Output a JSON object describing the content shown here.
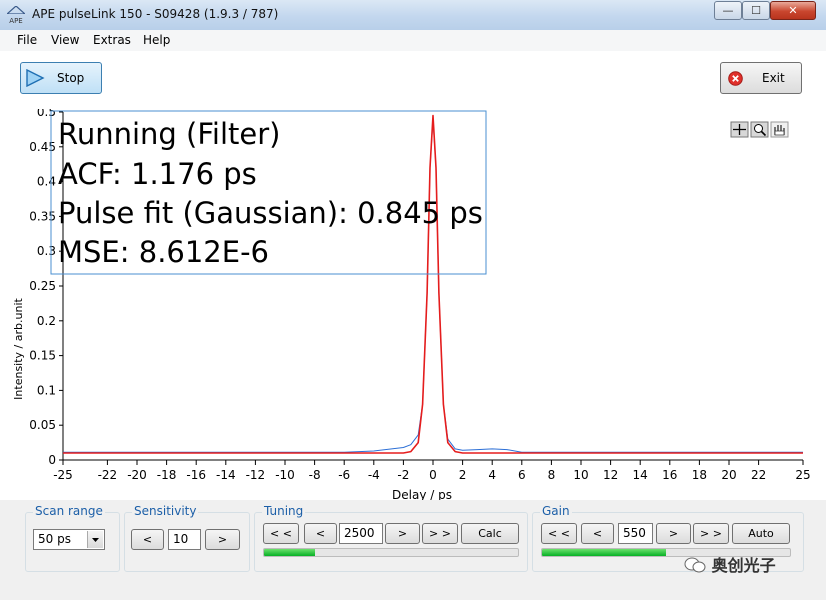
{
  "window": {
    "title": "APE pulseLink 150 - S09428 (1.9.3 / 787)",
    "app_icon_text": "APE"
  },
  "window_buttons": {
    "minimize": "—",
    "maximize": "☐",
    "close": "✕"
  },
  "menu": [
    "File",
    "View",
    "Extras",
    "Help"
  ],
  "toolbar": {
    "stop_label": "Stop",
    "exit_label": "Exit"
  },
  "colors": {
    "measured": "#2c6fd6",
    "fit": "#e51d1d",
    "accent": "#1c5fa8",
    "progress": "#06b025"
  },
  "chart_data": {
    "type": "line",
    "xlabel": "Delay / ps",
    "ylabel": "Intensity / arb.unit",
    "xlim": [
      -25,
      25
    ],
    "ylim": [
      0,
      0.5
    ],
    "xticks": [
      -25,
      -22,
      -20,
      -18,
      -16,
      -14,
      -12,
      -10,
      -8,
      -6,
      -4,
      -2,
      0,
      2,
      4,
      6,
      8,
      10,
      12,
      14,
      16,
      18,
      20,
      22,
      25
    ],
    "yticks": [
      0,
      0.05,
      0.1,
      0.15,
      0.2,
      0.25,
      0.3,
      0.35,
      0.4,
      0.45,
      0.5
    ],
    "grid": false,
    "annotation_lines": [
      "Running (Filter)",
      "ACF: 1.176 ps",
      "Pulse fit (Gaussian): 0.845 ps",
      "MSE: 8.612E-6"
    ],
    "series": [
      {
        "x": [
          -25,
          -6,
          -4,
          -2,
          -1.5,
          -1,
          -0.7,
          -0.4,
          -0.2,
          0,
          0.2,
          0.4,
          0.7,
          1,
          1.5,
          2,
          3,
          4,
          5,
          6,
          25
        ],
        "y": [
          0.011,
          0.011,
          0.013,
          0.018,
          0.022,
          0.036,
          0.08,
          0.24,
          0.42,
          0.49,
          0.42,
          0.24,
          0.08,
          0.03,
          0.016,
          0.014,
          0.015,
          0.016,
          0.015,
          0.011,
          0.011
        ]
      },
      {
        "x": [
          -25,
          -3,
          -2,
          -1.5,
          -1,
          -0.7,
          -0.4,
          -0.2,
          0,
          0.2,
          0.4,
          0.7,
          1,
          1.5,
          2,
          3,
          25
        ],
        "y": [
          0.01,
          0.01,
          0.01,
          0.012,
          0.025,
          0.08,
          0.24,
          0.42,
          0.495,
          0.42,
          0.24,
          0.08,
          0.025,
          0.012,
          0.01,
          0.01,
          0.01
        ]
      }
    ]
  },
  "chart_tools": [
    "crosshair-icon",
    "zoom-icon",
    "pan-icon"
  ],
  "panel": {
    "scan_range": {
      "label": "Scan range",
      "value": "50 ps"
    },
    "sensitivity": {
      "label": "Sensitivity",
      "value": "10",
      "dec": "<",
      "inc": ">"
    },
    "tuning": {
      "label": "Tuning",
      "value": "2500",
      "fast_dec": "< <",
      "dec": "<",
      "inc": ">",
      "fast_inc": "> >",
      "calc": "Calc",
      "level": 0.2
    },
    "gain": {
      "label": "Gain",
      "value": "550",
      "fast_dec": "< <",
      "dec": "<",
      "inc": ">",
      "fast_inc": "> >",
      "auto": "Auto",
      "level": 0.5
    }
  },
  "watermark": "奥创光子"
}
